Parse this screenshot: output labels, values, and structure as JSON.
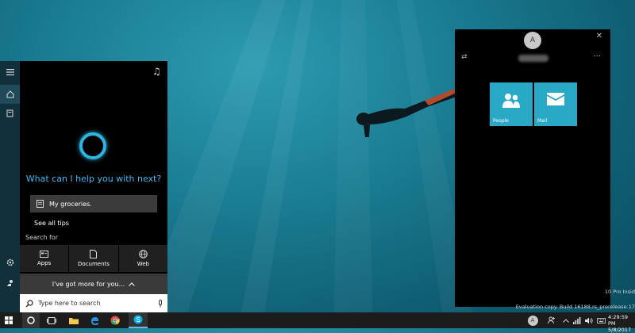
{
  "cortana": {
    "prompt": "What can I help you with next?",
    "tip_text": "My groceries.",
    "see_all_tips": "See all tips",
    "search_for_label": "Search for",
    "categories": [
      "Apps",
      "Documents",
      "Web"
    ],
    "more_label": "I've got more for you...",
    "search_placeholder": "Type here to search"
  },
  "people_panel": {
    "avatar_letter": "A",
    "tiles": [
      "People",
      "Mail"
    ]
  },
  "watermark": {
    "line1": "10 Pro Insid",
    "line2": "Evaluation copy. Build 16188.rs_prerelease.17"
  },
  "taskbar": {
    "time": "4:29:59 PM",
    "date": "5/8/2017",
    "people_avatar_letter": "A"
  },
  "colors": {
    "accent": "#2aa9c6",
    "cortana_ring": "#2fb6e0"
  }
}
